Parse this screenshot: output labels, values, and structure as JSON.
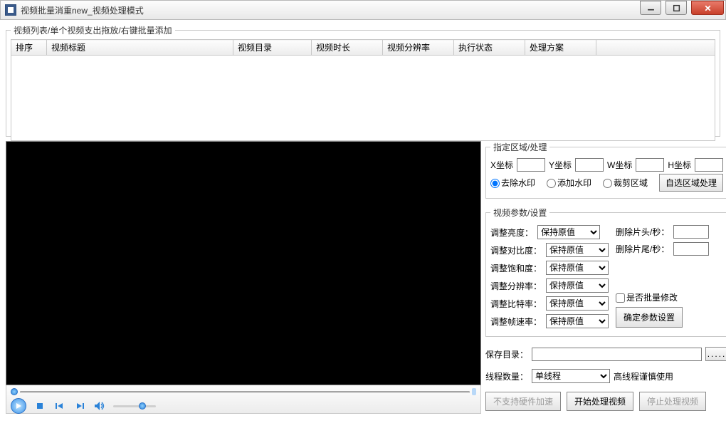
{
  "window": {
    "title": "视频批量消重new_视频处理模式"
  },
  "listgroup": {
    "legend": "视频列表/单个视频支出拖放/右键批量添加"
  },
  "columns": [
    "排序",
    "视频标题",
    "视频目录",
    "视频时长",
    "视频分辨率",
    "执行状态",
    "处理方案"
  ],
  "region": {
    "legend": "指定区域/处理",
    "xlabel": "X坐标",
    "ylabel": "Y坐标",
    "wlabel": "W坐标",
    "hlabel": "H坐标",
    "x": "",
    "y": "",
    "w": "",
    "h": "",
    "opt_remove": "去除水印",
    "opt_add": "添加水印",
    "opt_crop": "裁剪区域",
    "select_btn": "自选区域处理"
  },
  "params": {
    "legend": "视频参数/设置",
    "brightness_lbl": "调整亮度：",
    "keep": "保持原值",
    "contrast_lbl": "调整对比度：",
    "saturation_lbl": "调整饱和度：",
    "resolution_lbl": "调整分辨率：",
    "bitrate_lbl": "调整比特率：",
    "framerate_lbl": "调整帧速率：",
    "trim_head_lbl": "删除片头/秒：",
    "trim_head": "",
    "trim_tail_lbl": "删除片尾/秒：",
    "trim_tail": "",
    "batch_lbl": "是否批量修改",
    "confirm_btn": "确定参数设置"
  },
  "save": {
    "dir_lbl": "保存目录：",
    "dir": "",
    "browse": "....."
  },
  "threads": {
    "lbl": "线程数量：",
    "value": "单线程",
    "hint": "高线程谨慎使用"
  },
  "actions": {
    "hwaccel": "不支持硬件加速",
    "start": "开始处理视频",
    "stop": "停止处理视频"
  }
}
